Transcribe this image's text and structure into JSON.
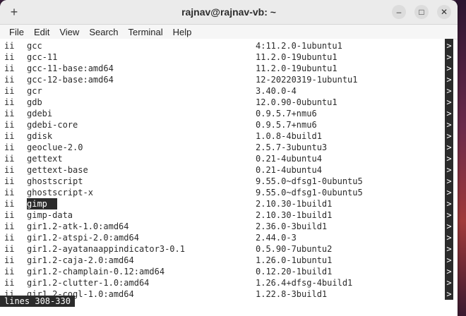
{
  "window": {
    "title": "rajnav@rajnav-vb: ~",
    "new_tab_icon": "+",
    "minimize_icon": "–",
    "maximize_icon": "□",
    "close_icon": "✕"
  },
  "menu": [
    "File",
    "Edit",
    "View",
    "Search",
    "Terminal",
    "Help"
  ],
  "rows": [
    {
      "status": "ii",
      "name": "gcc",
      "version": "4:11.2.0-1ubuntu1"
    },
    {
      "status": "ii",
      "name": "gcc-11",
      "version": "11.2.0-19ubuntu1"
    },
    {
      "status": "ii",
      "name": "gcc-11-base:amd64",
      "version": "11.2.0-19ubuntu1"
    },
    {
      "status": "ii",
      "name": "gcc-12-base:amd64",
      "version": "12-20220319-1ubuntu1"
    },
    {
      "status": "ii",
      "name": "gcr",
      "version": "3.40.0-4"
    },
    {
      "status": "ii",
      "name": "gdb",
      "version": "12.0.90-0ubuntu1"
    },
    {
      "status": "ii",
      "name": "gdebi",
      "version": "0.9.5.7+nmu6"
    },
    {
      "status": "ii",
      "name": "gdebi-core",
      "version": "0.9.5.7+nmu6"
    },
    {
      "status": "ii",
      "name": "gdisk",
      "version": "1.0.8-4build1"
    },
    {
      "status": "ii",
      "name": "geoclue-2.0",
      "version": "2.5.7-3ubuntu3"
    },
    {
      "status": "ii",
      "name": "gettext",
      "version": "0.21-4ubuntu4"
    },
    {
      "status": "ii",
      "name": "gettext-base",
      "version": "0.21-4ubuntu4"
    },
    {
      "status": "ii",
      "name": "ghostscript",
      "version": "9.55.0~dfsg1-0ubuntu5"
    },
    {
      "status": "ii",
      "name": "ghostscript-x",
      "version": "9.55.0~dfsg1-0ubuntu5"
    },
    {
      "status": "ii",
      "name": "gimp",
      "version": "2.10.30-1build1",
      "selected": true
    },
    {
      "status": "ii",
      "name": "gimp-data",
      "version": "2.10.30-1build1"
    },
    {
      "status": "ii",
      "name": "gir1.2-atk-1.0:amd64",
      "version": "2.36.0-3build1"
    },
    {
      "status": "ii",
      "name": "gir1.2-atspi-2.0:amd64",
      "version": "2.44.0-3"
    },
    {
      "status": "ii",
      "name": "gir1.2-ayatanaappindicator3-0.1",
      "version": "0.5.90-7ubuntu2"
    },
    {
      "status": "ii",
      "name": "gir1.2-caja-2.0:amd64",
      "version": "1.26.0-1ubuntu1"
    },
    {
      "status": "ii",
      "name": "gir1.2-champlain-0.12:amd64",
      "version": "0.12.20-1build1"
    },
    {
      "status": "ii",
      "name": "gir1.2-clutter-1.0:amd64",
      "version": "1.26.4+dfsg-4build1"
    },
    {
      "status": "ii",
      "name": "gir1.2-cogl-1.0:amd64",
      "version": "1.22.8-3build1"
    }
  ],
  "overflow_marker": ">",
  "status_line": "lines 308-330"
}
